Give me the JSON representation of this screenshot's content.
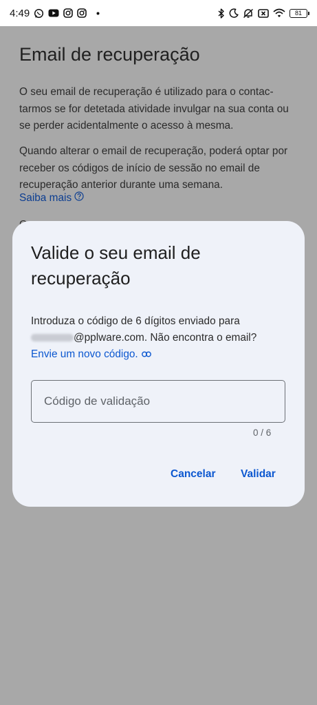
{
  "status_bar": {
    "time": "4:49",
    "battery": "81",
    "left_icons": [
      "whatsapp-icon",
      "youtube-icon",
      "instagram-icon",
      "instagram-icon",
      "dot-icon"
    ],
    "right_icons": [
      "bluetooth-icon",
      "moon-icon",
      "silent-icon",
      "no-sim-icon",
      "wifi-icon",
      "battery-icon"
    ]
  },
  "page": {
    "title": "Email de recuperação",
    "paragraph_1": "O seu email de recuperação é utilizado para o contac-tarmos se for detetada atividade invulgar na sua conta ou se perder acidentalmente o acesso à mesma.",
    "paragraph_2": "Quando alterar o email de recuperação, poderá optar por receber os códigos de início de sessão no email de recuperação anterior durante uma semana.",
    "learn_more": "Saiba mais",
    "peek_text": "C"
  },
  "dialog": {
    "title": "Valide o seu email de recuperação",
    "body_intro": "Introduza o código de 6 dígitos enviado para",
    "email_suffix": "@pplware.com. Não encontra o email?",
    "resend_link": "Envie um novo código.",
    "input_placeholder": "Código de validação",
    "input_value": "",
    "counter": "0 / 6",
    "cancel_label": "Cancelar",
    "validate_label": "Validar"
  },
  "colors": {
    "scrim": "#a8a8a8",
    "dialog_bg": "#eff2f9",
    "accent": "#0b57d0",
    "link_dimmed": "#0b3d91"
  }
}
